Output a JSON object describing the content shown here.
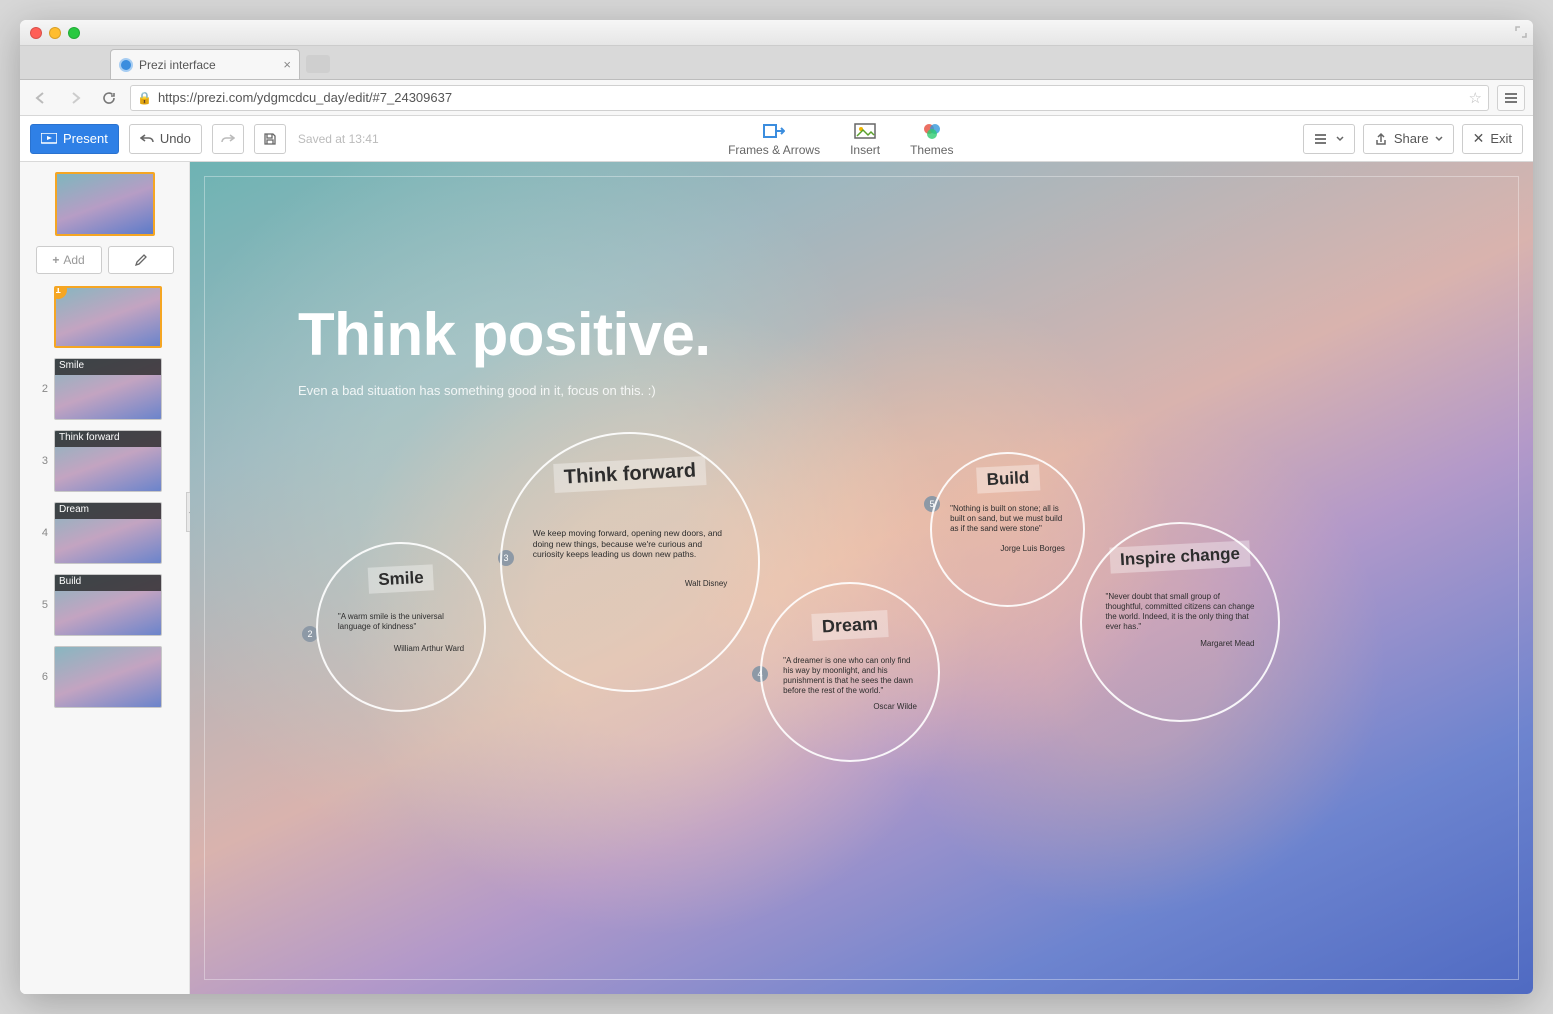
{
  "browser": {
    "tab_title": "Prezi interface",
    "url": "https://prezi.com/ydgmcdcu_day/edit/#7_24309637"
  },
  "toolbar": {
    "present": "Present",
    "undo": "Undo",
    "save_status": "Saved at 13:41",
    "frames_arrows": "Frames & Arrows",
    "insert": "Insert",
    "themes": "Themes",
    "share": "Share",
    "exit": "Exit"
  },
  "sidebar": {
    "add": "Add",
    "thumbs": [
      {
        "num": "1",
        "label": "",
        "selected": true,
        "badge": "1"
      },
      {
        "num": "2",
        "label": "Smile"
      },
      {
        "num": "3",
        "label": "Think forward"
      },
      {
        "num": "4",
        "label": "Dream"
      },
      {
        "num": "5",
        "label": "Build"
      },
      {
        "num": "6",
        "label": ""
      }
    ]
  },
  "canvas": {
    "title": "Think positive.",
    "subtitle": "Even a bad situation has something good in it, focus on this.  :)",
    "bubbles": {
      "smile": {
        "title": "Smile",
        "quote": "\"A warm smile is the universal language of kindness\"",
        "author": "William Arthur Ward"
      },
      "think": {
        "title": "Think forward",
        "quote": "We keep moving forward, opening new doors, and doing new things, because we're curious and curiosity keeps leading us down new paths.",
        "author": "Walt Disney"
      },
      "dream": {
        "title": "Dream",
        "quote": "\"A dreamer is one who can only find his way by moonlight, and his punishment is that he sees the dawn before the rest of the world.\"",
        "author": "Oscar Wilde"
      },
      "build": {
        "title": "Build",
        "quote": "\"Nothing is built on stone; all is built on sand, but we must build as if the sand were stone\"",
        "author": "Jorge Luis Borges"
      },
      "inspire": {
        "title": "Inspire change",
        "quote": "\"Never doubt that small group of thoughtful, committed citizens can change the world. Indeed, it is the only thing that ever has.\"",
        "author": "Margaret Mead"
      }
    },
    "path_nums": {
      "n2": "2",
      "n3": "3",
      "n4": "4",
      "n5": "5"
    }
  }
}
